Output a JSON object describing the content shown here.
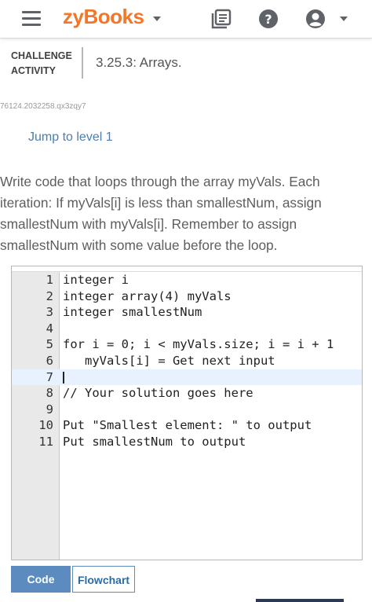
{
  "header": {
    "brand": "zyBooks"
  },
  "activity": {
    "type_line1": "CHALLENGE",
    "type_line2": "ACTIVITY",
    "title": "3.25.3: Arrays.",
    "id": "76124.2032258.qx3zqy7",
    "jump_label": "Jump to level 1"
  },
  "prompt": {
    "lines": [
      "Write code that loops through the array myVals. Each",
      "iteration: If myVals[i] is less than smallestNum, assign",
      "smallestNum with myVals[i]. Remember to assign",
      "smallestNum with some value before the loop."
    ]
  },
  "editor": {
    "lines": [
      {
        "num": "1",
        "text": "integer i"
      },
      {
        "num": "2",
        "text": "integer array(4) myVals"
      },
      {
        "num": "3",
        "text": "integer smallestNum"
      },
      {
        "num": "4",
        "text": ""
      },
      {
        "num": "5",
        "text": "for i = 0; i < myVals.size; i = i + 1"
      },
      {
        "num": "6",
        "text": "   myVals[i] = Get next input"
      },
      {
        "num": "7",
        "text": ""
      },
      {
        "num": "8",
        "text": "// Your solution goes here"
      },
      {
        "num": "9",
        "text": ""
      },
      {
        "num": "10",
        "text": "Put \"Smallest element: \" to output"
      },
      {
        "num": "11",
        "text": "Put smallestNum to output"
      }
    ],
    "active_line": 7
  },
  "tabs": {
    "code": "Code",
    "flowchart": "Flowchart"
  },
  "colors": {
    "brand": "#f3772a",
    "link": "#4a7fb0",
    "active_tab": "#5c8cbf"
  },
  "icons": [
    "hamburger-menu-icon",
    "chevron-down-icon",
    "library-icon",
    "help-icon",
    "account-icon"
  ]
}
